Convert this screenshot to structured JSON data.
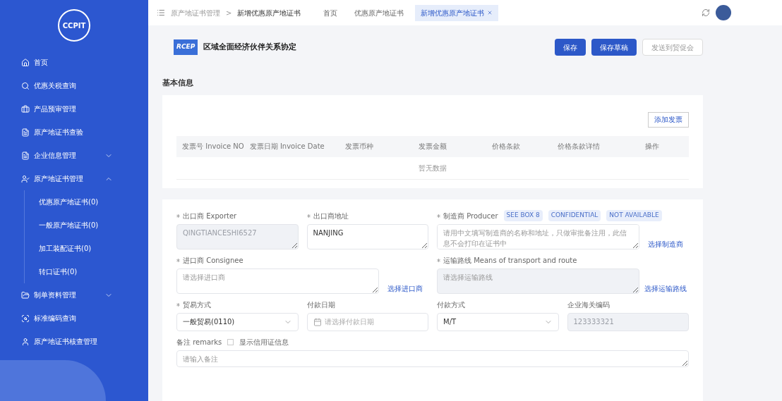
{
  "sidebar": {
    "logo": "CCPIT",
    "items": [
      {
        "label": "首页"
      },
      {
        "label": "优惠关税查询"
      },
      {
        "label": "产品预审管理"
      },
      {
        "label": "原产地证书查验"
      },
      {
        "label": "企业信息管理",
        "expanded": false
      },
      {
        "label": "原产地证书管理",
        "expanded": true,
        "children": [
          {
            "label": "优惠原产地证书(0)"
          },
          {
            "label": "一般原产地证书(0)"
          },
          {
            "label": "加工装配证书(0)"
          },
          {
            "label": "转口证书(0)"
          }
        ]
      },
      {
        "label": "制单资料管理",
        "expanded": false
      },
      {
        "label": "标准编码查询"
      },
      {
        "label": "原产地证书核查管理"
      }
    ]
  },
  "breadcrumb": {
    "items": [
      "原产地证书管理",
      "新增优惠原产地证书"
    ],
    "separator": ">"
  },
  "tabs": [
    {
      "label": "首页",
      "selected": false,
      "closable": false
    },
    {
      "label": "优惠原产地证书",
      "selected": false,
      "closable": false
    },
    {
      "label": "新增优惠原产地证书",
      "selected": true,
      "closable": true
    }
  ],
  "header": {
    "logo": "RCEP",
    "title": "区域全面经济伙伴关系协定",
    "buttons": [
      {
        "label": "保存",
        "primary": true
      },
      {
        "label": "保存草稿",
        "primary": true
      },
      {
        "label": "发送到贸促会",
        "primary": false
      }
    ]
  },
  "section_title": "基本信息",
  "invoices": {
    "add_button": "添加发票",
    "columns": [
      "发票号 Invoice NO",
      "发票日期 Invoice Date",
      "发票币种",
      "发票金额",
      "价格条款",
      "价格条款详情",
      "操作"
    ],
    "empty_text": "暂无数据"
  },
  "form": {
    "groups": [
      {
        "fields": [
          {
            "label": "出口商 Exporter",
            "required": true,
            "kind": "textarea",
            "value": "QINGTIANCESHI6527",
            "disabled": true
          },
          {
            "label": "出口商地址",
            "required": true,
            "kind": "textarea",
            "value": "NANJING",
            "disabled": false
          },
          {
            "label": "制造商 Producer",
            "required": true,
            "kind": "textarea",
            "tags": [
              "SEE BOX 8",
              "CONFIDENTIAL",
              "NOT AVAILABLE"
            ],
            "placeholder": "请用中文填写制造商的名称和地址，只做审批备注用，此信息不会打印在证书中",
            "disabled": false,
            "action": "选择制造商"
          }
        ]
      },
      {
        "fields": [
          {
            "label": "进口商 Consignee",
            "required": true,
            "kind": "textarea",
            "placeholder": "请选择进口商",
            "disabled": false,
            "action": "选择进口商"
          },
          {
            "label": "运输路线 Means of transport and route",
            "required": true,
            "kind": "textarea",
            "placeholder": "请选择运输路线",
            "disabled": true,
            "action": "选择运输路线"
          }
        ]
      },
      {
        "fields": [
          {
            "label": "贸易方式",
            "required": true,
            "kind": "select",
            "value": "一般贸易(0110)",
            "disabled": false
          },
          {
            "label": "付款日期",
            "required": false,
            "kind": "date",
            "placeholder": "请选择付款日期",
            "disabled": false
          },
          {
            "label": "付款方式",
            "required": false,
            "kind": "select",
            "value": "M/T",
            "disabled": false
          },
          {
            "label": "企业海关编码",
            "required": false,
            "kind": "input",
            "value": "123333321",
            "disabled": true
          }
        ]
      }
    ],
    "remarks": {
      "label": "备注 remarks",
      "checkbox": {
        "label": "显示信用证信息",
        "checked": false
      },
      "placeholder": "请输入备注"
    }
  }
}
